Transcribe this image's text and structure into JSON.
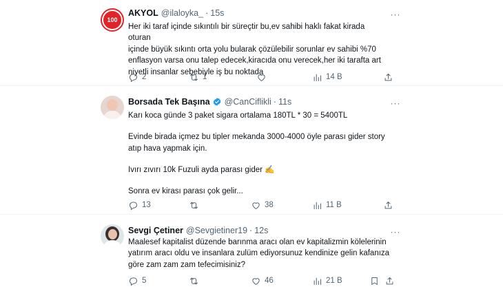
{
  "tweets": [
    {
      "name": "AKYOL",
      "handle": "@ilaloyka_",
      "time": "15s",
      "avatar_text": "100",
      "lines": [
        "Her iki taraf içinde sıkıntılı bir süreçtir bu,ev sahibi haklı fakat kirada oturan",
        "içinde büyük sıkıntı orta yolu bularak çözülebilir sorunlar ev sahibi %70",
        "enflasyon varsa onu talep edecek,kiracıda onu verecek,her iki tarafta art",
        "niyetli insanlar sebebiyle iş bu noktada"
      ],
      "replies": "2",
      "retweets": "1",
      "likes": "",
      "views": "14 B"
    },
    {
      "name": "Borsada Tek Başına",
      "verified": true,
      "handle": "@CanCiflikli",
      "time": "11s",
      "paragraphs": [
        "Karı koca günde 3 paket sigara ortalama 180TL * 30 = 5400TL",
        "Evinde birada içmez bu tipler mekanda 3000-4000 öyle parası gider story\natıp hava yapmak için.",
        "Ivırı zıvırı 10k Fuzuli ayda parası gider ✍️",
        "Sonra ev kirası parası çok gelir..."
      ],
      "replies": "13",
      "retweets": "",
      "likes": "38",
      "views": "11 B"
    },
    {
      "name": "Sevgi Çetiner",
      "handle": "@Sevgietiner19",
      "time": "12s",
      "lines": [
        "Maalesef kapitalist düzende barınma aracı olan ev kapitalizmin kölelerinin",
        "yatırım aracı oldu ve insanlara zulüm ediyorsunuz kendinize gelin kafanıza",
        "göre zam zam zam tefecimisiniz?"
      ],
      "replies": "5",
      "retweets": "",
      "likes": "46",
      "views": "21 B"
    }
  ],
  "more_label": "···"
}
